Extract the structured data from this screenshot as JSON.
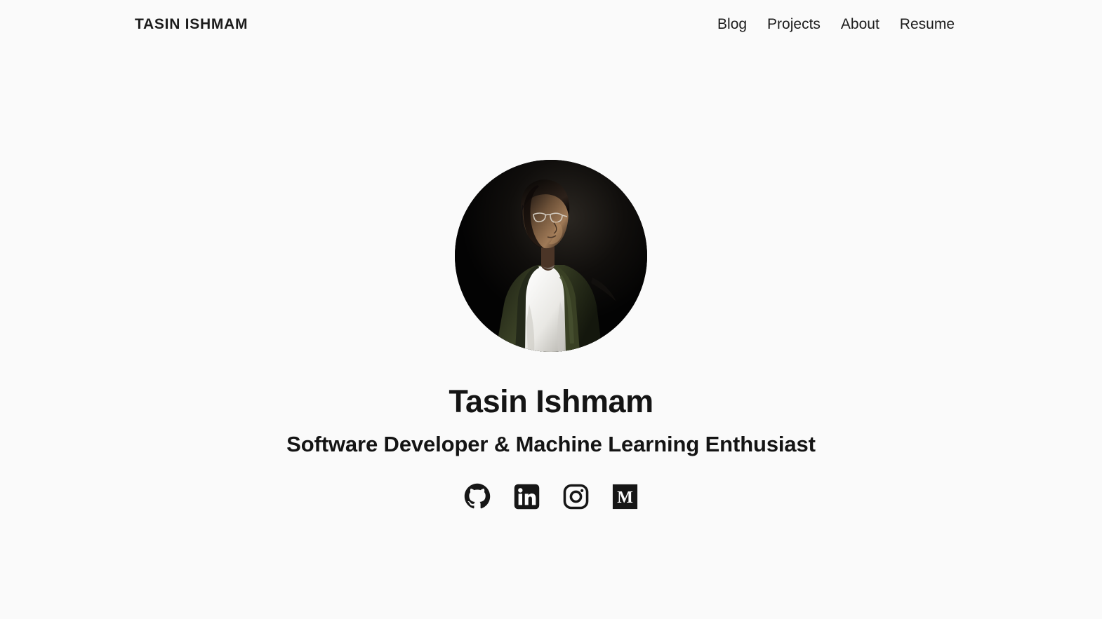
{
  "colors": {
    "background": "#fafafa",
    "text": "#1c1c1c",
    "heading": "#141414",
    "icon": "#161616",
    "photo_backdrop": "#050505",
    "photo_jacket": "#333a22",
    "photo_shirt": "#f0efed",
    "photo_skin": "#8a6a51"
  },
  "header": {
    "brand": "TASIN ISHMAM",
    "nav": [
      {
        "label": "Blog",
        "name": "nav-link-blog"
      },
      {
        "label": "Projects",
        "name": "nav-link-projects"
      },
      {
        "label": "About",
        "name": "nav-link-about"
      },
      {
        "label": "Resume",
        "name": "nav-link-resume"
      }
    ]
  },
  "hero": {
    "avatar_alt": "Portrait photo of Tasin Ishmam",
    "name": "Tasin Ishmam",
    "tagline": "Software Developer & Machine Learning Enthusiast",
    "socials": [
      {
        "label": "GitHub",
        "icon": "github-icon"
      },
      {
        "label": "LinkedIn",
        "icon": "linkedin-icon"
      },
      {
        "label": "Instagram",
        "icon": "instagram-icon"
      },
      {
        "label": "Medium",
        "icon": "medium-icon"
      }
    ]
  }
}
